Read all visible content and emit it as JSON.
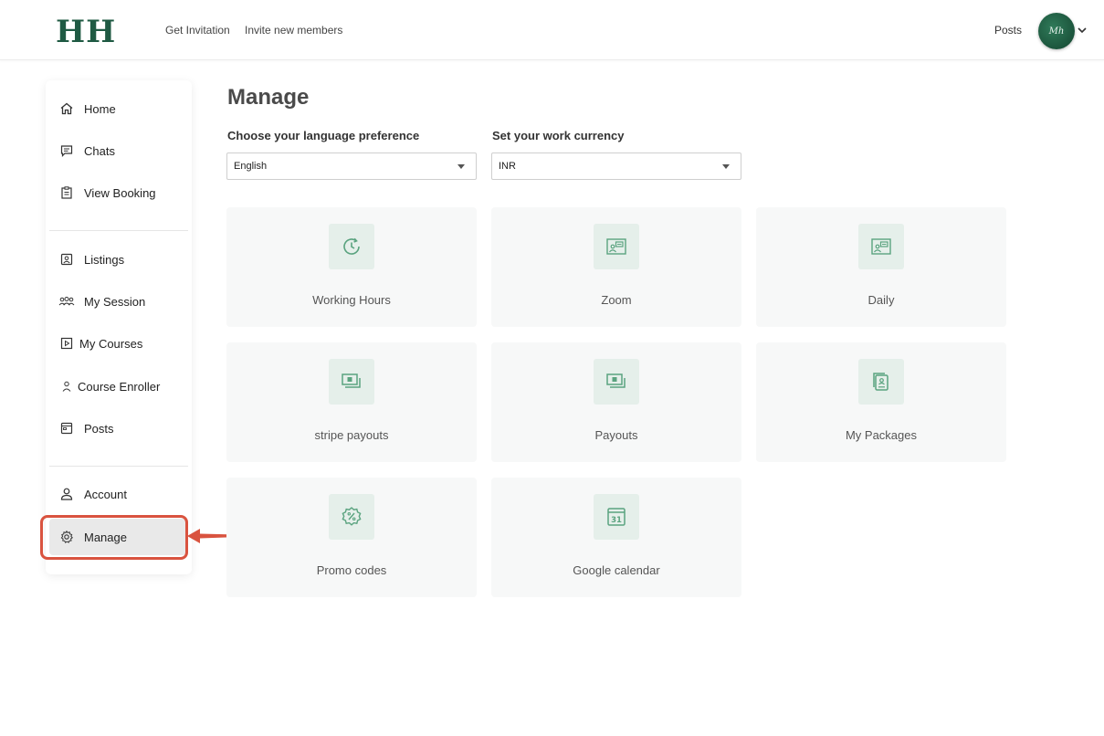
{
  "header": {
    "logo": "HH",
    "nav": [
      "Get Invitation",
      "Invite new members"
    ],
    "posts_label": "Posts",
    "avatar_text": "Mh"
  },
  "sidebar": {
    "group1": [
      {
        "label": "Home",
        "icon": "home-icon"
      },
      {
        "label": "Chats",
        "icon": "chat-icon"
      },
      {
        "label": "View Booking",
        "icon": "clipboard-icon"
      }
    ],
    "group2": [
      {
        "label": "Listings",
        "icon": "id-card-icon"
      },
      {
        "label": "My Session",
        "icon": "group-icon"
      },
      {
        "label": "My Courses",
        "icon": "play-icon"
      },
      {
        "label": "Course Enroller",
        "icon": "person-icon"
      },
      {
        "label": "Posts",
        "icon": "browser-icon"
      }
    ],
    "group3": [
      {
        "label": "Account",
        "icon": "user-icon"
      },
      {
        "label": "Manage",
        "icon": "gear-icon",
        "active": true
      }
    ]
  },
  "main": {
    "title": "Manage",
    "language_label": "Choose your language preference",
    "language_value": "English",
    "currency_label": "Set your work currency",
    "currency_value": "INR",
    "cards": [
      {
        "label": "Working Hours",
        "icon": "clock-refresh-icon"
      },
      {
        "label": "Zoom",
        "icon": "video-card-icon"
      },
      {
        "label": "Daily",
        "icon": "video-card-icon"
      },
      {
        "label": "stripe payouts",
        "icon": "cash-icon"
      },
      {
        "label": "Payouts",
        "icon": "cash-icon"
      },
      {
        "label": "My Packages",
        "icon": "package-icon"
      },
      {
        "label": "Promo codes",
        "icon": "discount-badge-icon"
      },
      {
        "label": "Google calendar",
        "icon": "calendar-icon"
      }
    ]
  },
  "colors": {
    "brand": "#1f5a43",
    "accent_icon": "#5aa37f",
    "highlight": "#d9533f"
  }
}
